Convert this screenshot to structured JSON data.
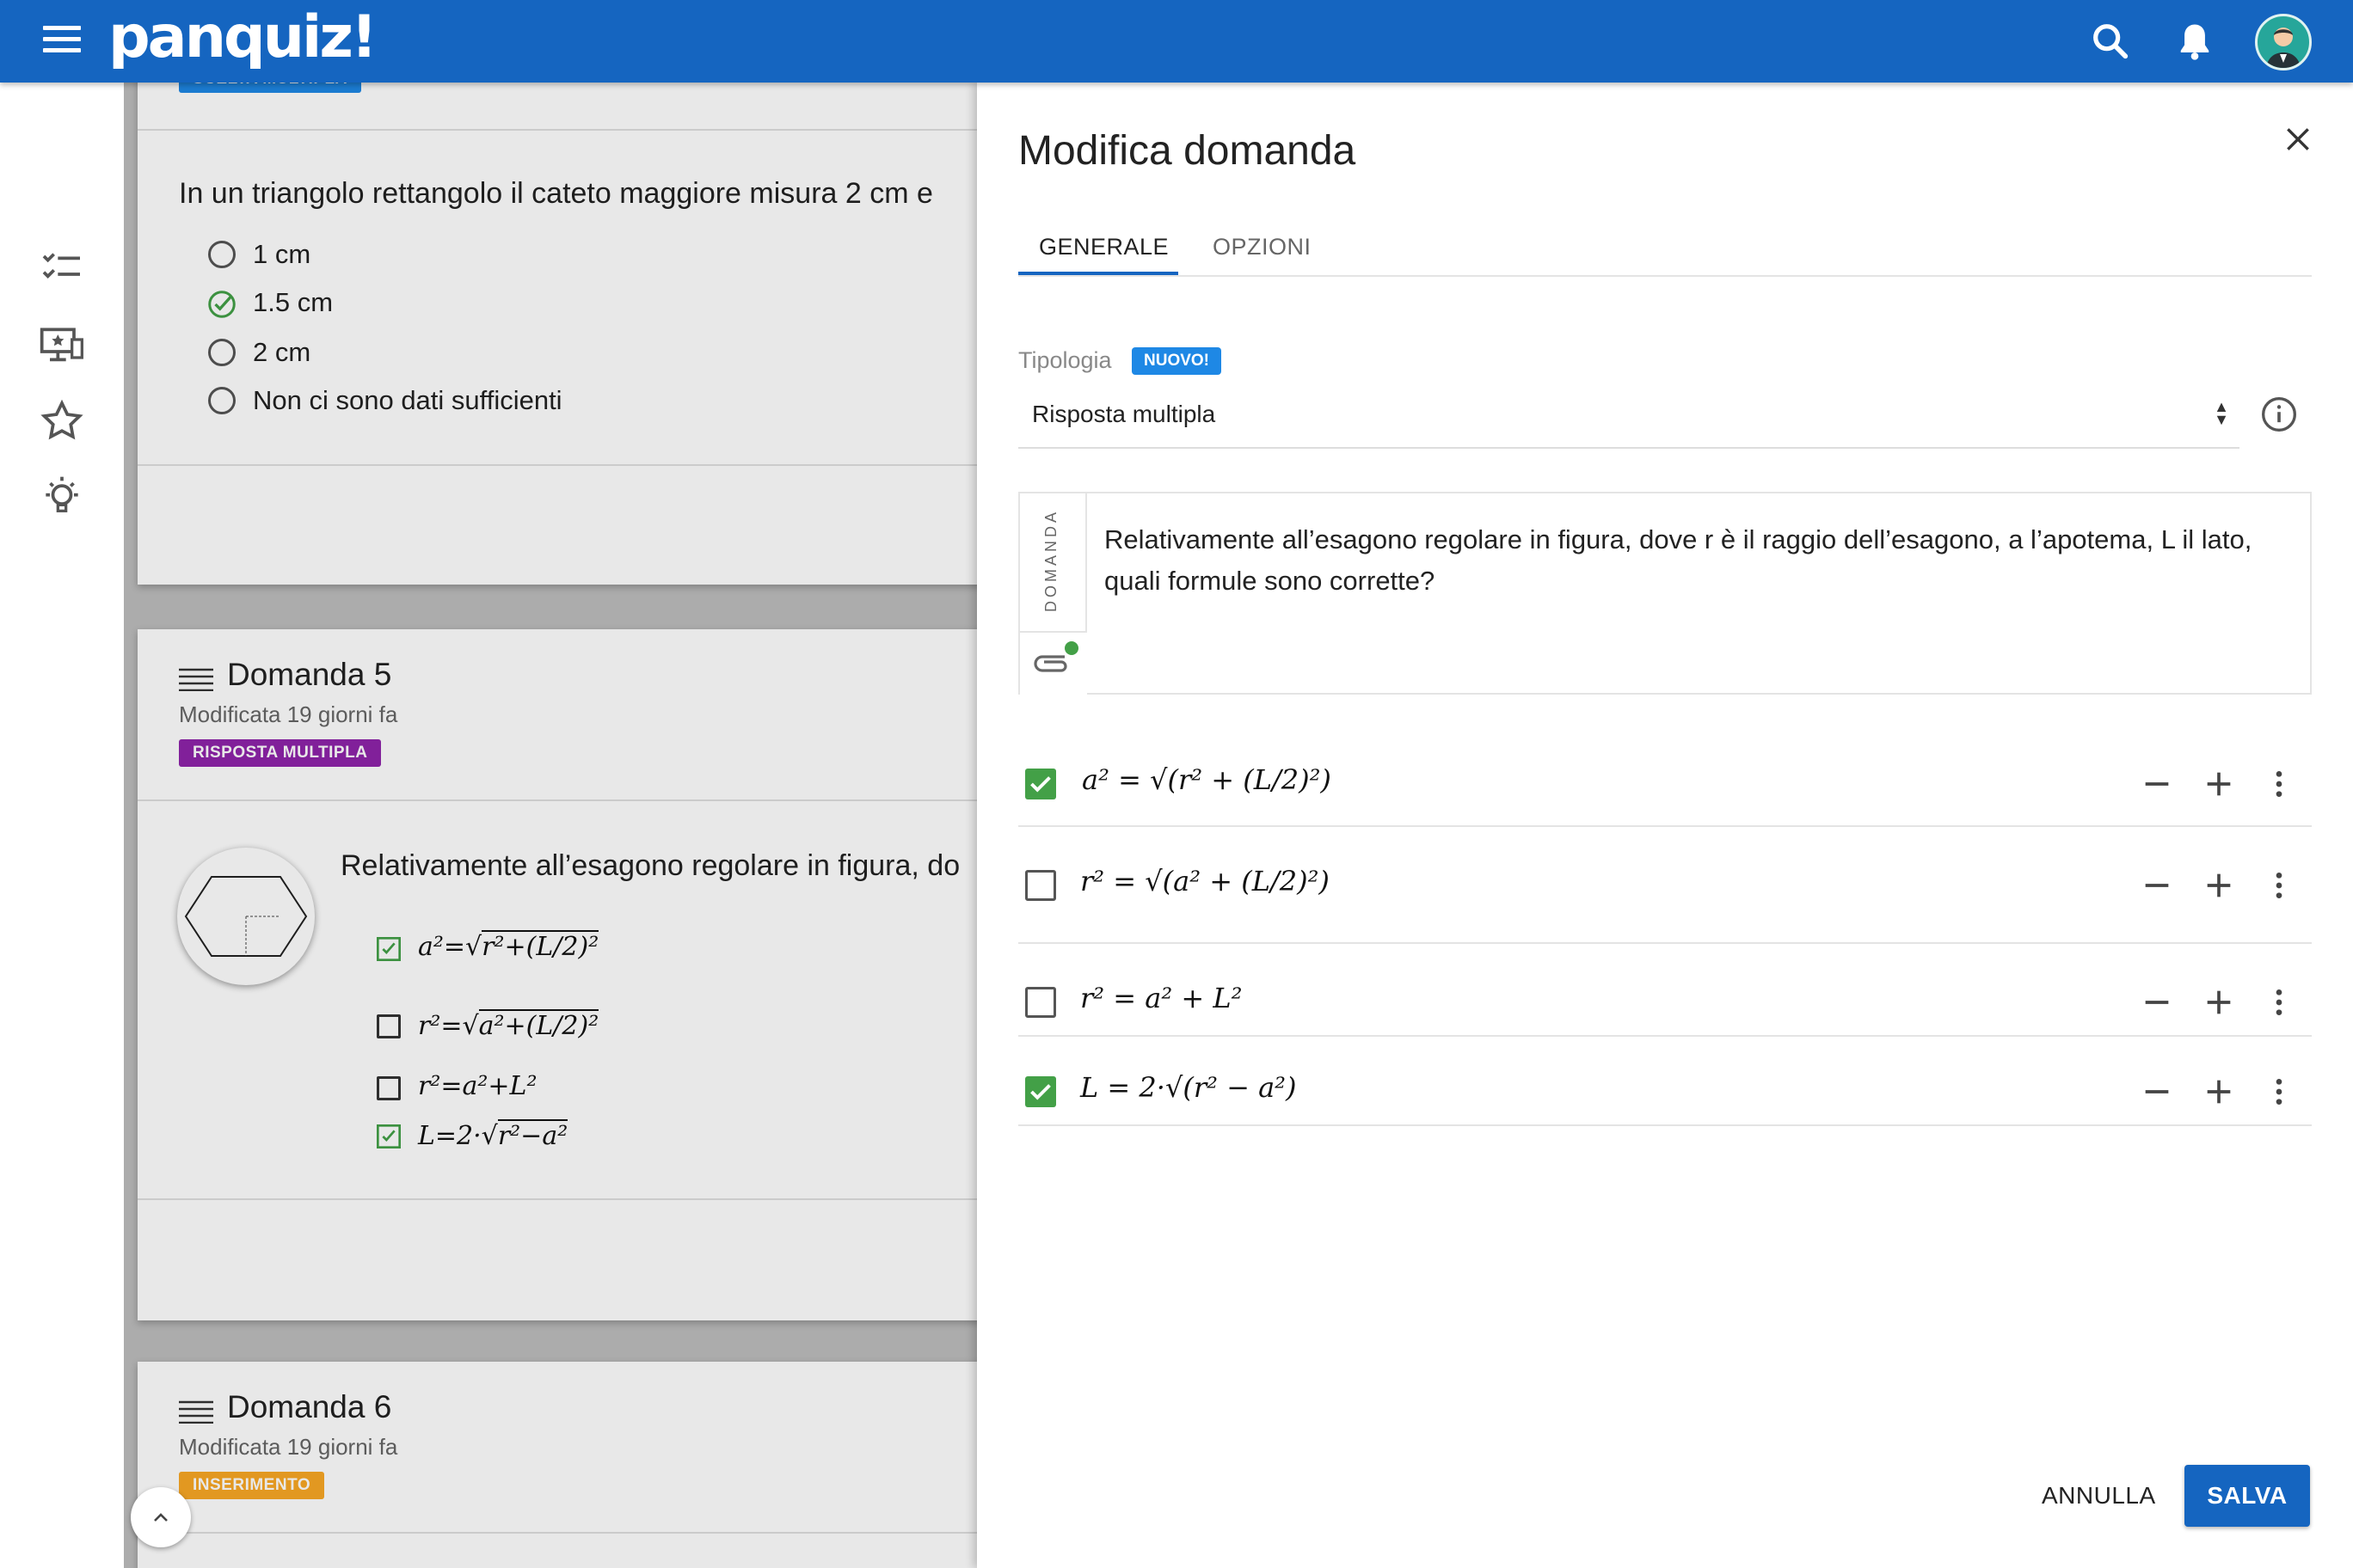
{
  "app": {
    "logo": "panquiz!"
  },
  "list": {
    "card4": {
      "tag": "SCELTA MULTIPLA",
      "question": "In un triangolo rettangolo il cateto maggiore misura 2 cm e",
      "options": [
        "1 cm",
        "1.5 cm",
        "2 cm",
        "Non ci sono dati sufficienti"
      ]
    },
    "card5": {
      "title": "Domanda 5",
      "modified": "Modificata 19 giorni fa",
      "tag": "RISPOSTA MULTIPLA",
      "question": "Relativamente all’esagono regolare in figura, do"
    },
    "card6": {
      "title": "Domanda 6",
      "modified": "Modificata 19 giorni fa",
      "tag": "INSERIMENTO"
    }
  },
  "panel": {
    "title": "Modifica domanda",
    "tabs": [
      "GENERALE",
      "OPZIONI"
    ],
    "type_label": "Tipologia",
    "new_badge": "NUOVO!",
    "type_value": "Risposta multipla",
    "question_side_label": "DOMANDA",
    "question_text": "Relativamente all’esagono regolare in figura, dove r è il raggio dell’esagono, a l’apotema, L il lato, quali formule sono corrette?",
    "answers": [
      {
        "formula": "a² = √(r² + (L/2)²)",
        "correct": true
      },
      {
        "formula": "r² = √(a² + (L/2)²)",
        "correct": false
      },
      {
        "formula": "r² = a² + L²",
        "correct": false
      },
      {
        "formula": "L = 2·√(r² − a²)",
        "correct": true
      }
    ],
    "cancel": "ANNULLA",
    "save": "SALVA"
  },
  "colors": {
    "primary": "#1565c0",
    "correct": "#43a047",
    "tag_scelta": "#1e88e5",
    "tag_risposta": "#8e24aa",
    "tag_inserimento": "#f9a825"
  }
}
